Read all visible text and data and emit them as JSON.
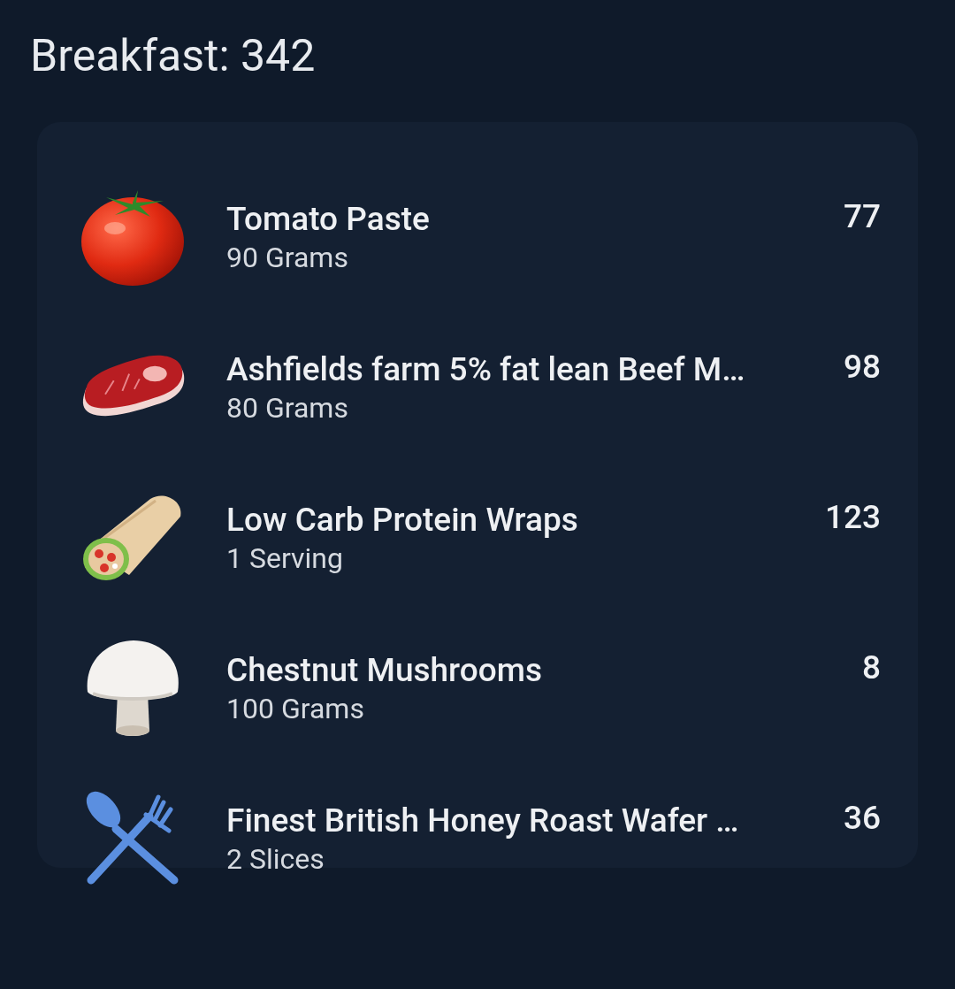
{
  "meal": {
    "title": "Breakfast: 342"
  },
  "items": [
    {
      "kind": "tomato",
      "name": "Tomato Paste",
      "amount": "90 Grams",
      "calories": "77"
    },
    {
      "kind": "steak",
      "name": "Ashfields farm 5% fat lean Beef M…",
      "amount": "80 Grams",
      "calories": "98"
    },
    {
      "kind": "wrap",
      "name": "Low Carb Protein Wraps",
      "amount": "1 Serving",
      "calories": "123"
    },
    {
      "kind": "mushroom",
      "name": "Chestnut Mushrooms",
      "amount": "100 Grams",
      "calories": "8"
    },
    {
      "kind": "utensils",
      "name": "Finest British Honey Roast Wafer …",
      "amount": "2 Slices",
      "calories": "36"
    }
  ]
}
